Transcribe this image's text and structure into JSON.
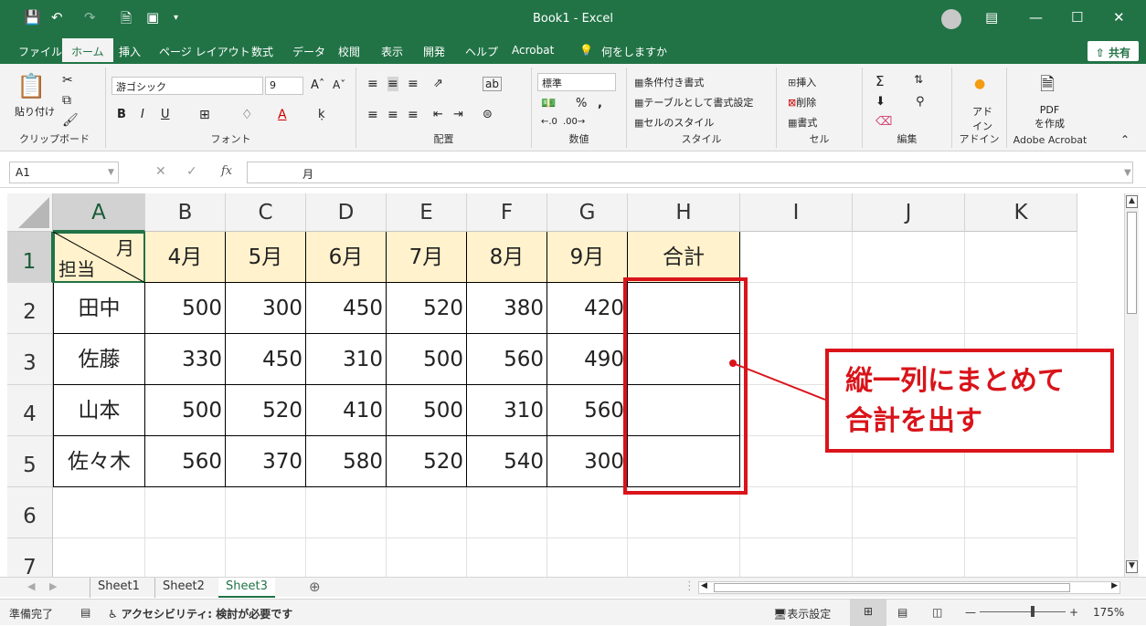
{
  "window": {
    "title": "Book1  -  Excel"
  },
  "menu": {
    "tabs": [
      "ファイル",
      "ホーム",
      "挿入",
      "ページ レイアウト",
      "数式",
      "データ",
      "校閲",
      "表示",
      "開発",
      "ヘルプ",
      "Acrobat"
    ],
    "search": "何をしますか",
    "share": "共有"
  },
  "ribbon": {
    "clipboard": {
      "paste": "貼り付け",
      "label": "クリップボード"
    },
    "font": {
      "name": "游ゴシック",
      "size": "9",
      "label": "フォント"
    },
    "align": {
      "label": "配置"
    },
    "number": {
      "format": "標準",
      "label": "数値"
    },
    "styles": {
      "cond": "条件付き書式",
      "table": "テーブルとして書式設定",
      "cell": "セルのスタイル",
      "label": "スタイル"
    },
    "cells": {
      "insert": "挿入",
      "delete": "削除",
      "format": "書式",
      "label": "セル"
    },
    "edit": {
      "label": "編集"
    },
    "addin": {
      "btn1": "アド",
      "btn2": "イン",
      "label": "アドイン"
    },
    "acrobat": {
      "btn1": "PDF",
      "btn2": "を作成",
      "label": "Adobe Acrobat"
    }
  },
  "formula": {
    "namebox": "A1",
    "fx": "fx",
    "value": "月"
  },
  "grid": {
    "columns": [
      "A",
      "B",
      "C",
      "D",
      "E",
      "F",
      "G",
      "H",
      "I",
      "J",
      "K"
    ],
    "rows": [
      "1",
      "2",
      "3",
      "4",
      "5",
      "6",
      "7"
    ],
    "a1_top": "月",
    "a1_bottom": "担当",
    "headers": [
      "4月",
      "5月",
      "6月",
      "7月",
      "8月",
      "9月",
      "合計"
    ],
    "data": [
      {
        "name": "田中",
        "values": [
          "500",
          "300",
          "450",
          "520",
          "380",
          "420"
        ]
      },
      {
        "name": "佐藤",
        "values": [
          "330",
          "450",
          "310",
          "500",
          "560",
          "490"
        ]
      },
      {
        "name": "山本",
        "values": [
          "500",
          "520",
          "410",
          "500",
          "310",
          "560"
        ]
      },
      {
        "name": "佐々木",
        "values": [
          "560",
          "370",
          "580",
          "520",
          "540",
          "300"
        ]
      }
    ]
  },
  "sheets": {
    "tabs": [
      "Sheet1",
      "Sheet2",
      "Sheet3"
    ],
    "active": "Sheet3"
  },
  "status": {
    "ready": "準備完了",
    "accessibility": "アクセシビリティ: 検討が必要です",
    "display": "表示設定",
    "zoom": "175%"
  },
  "callout": {
    "line1": "縦一列にまとめて",
    "line2": "合計を出す"
  },
  "colors": {
    "excel_green": "#217346",
    "header_fill": "#fff2cc",
    "callout_red": "#d9141a"
  }
}
